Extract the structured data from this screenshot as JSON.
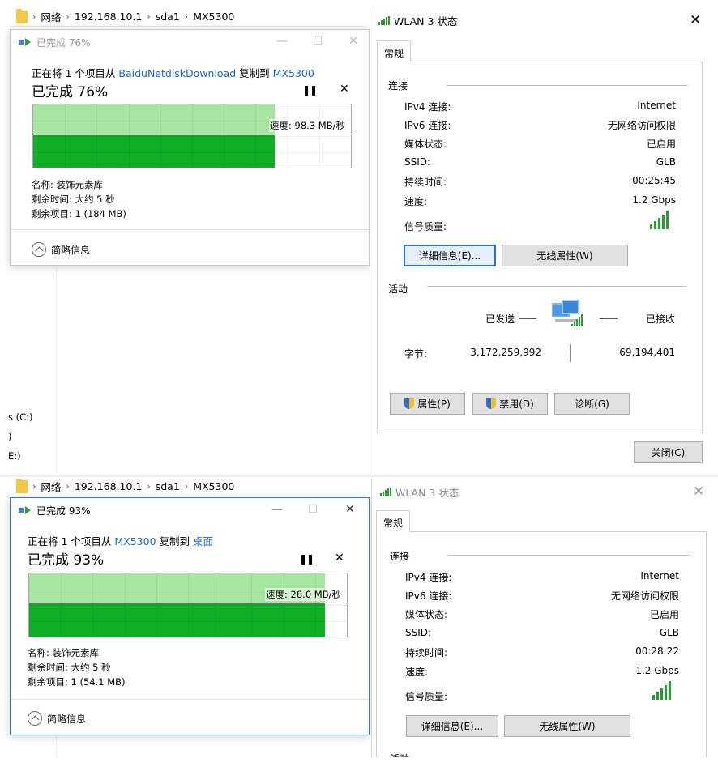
{
  "top": {
    "breadcrumb": [
      "网络",
      "192.168.10.1",
      "sda1",
      "MX5300"
    ],
    "drives": [
      "s (C:)",
      ")",
      "E:)"
    ],
    "copy": {
      "title": "已完成 76%",
      "line_prefix": "正在将 1 个项目从 ",
      "source": "BaiduNetdiskDownload",
      "line_mid": " 复制到 ",
      "dest": "MX5300",
      "percent_text": "已完成 76%",
      "progress": 0.76,
      "speed": "速度: 98.3 MB/秒",
      "name": "名称: 装饰元素库",
      "time_left": "剩余时间: 大约 5 秒",
      "items_left": "剩余项目: 1 (184 MB)",
      "less_info": "简略信息",
      "pause_icon": "pause-icon",
      "close_icon": "close-icon"
    },
    "wlan": {
      "title": "WLAN 3 状态",
      "tab": "常规",
      "connection_group": "连接",
      "rows": [
        {
          "label": "IPv4 连接:",
          "value": "Internet"
        },
        {
          "label": "IPv6 连接:",
          "value": "无网络访问权限"
        },
        {
          "label": "媒体状态:",
          "value": "已启用"
        },
        {
          "label": "SSID:",
          "value": "GLB"
        },
        {
          "label": "持续时间:",
          "value": "00:25:45"
        },
        {
          "label": "速度:",
          "value": "1.2 Gbps"
        }
      ],
      "signal_label": "信号质量:",
      "details_btn": "详细信息(E)...",
      "wireless_btn": "无线属性(W)",
      "activity_group": "活动",
      "sent_label": "已发送",
      "recv_label": "已接收",
      "bytes_label": "字节:",
      "bytes_sent": "3,172,259,992",
      "bytes_recv": "69,194,401",
      "props_btn": "属性(P)",
      "disable_btn": "禁用(D)",
      "diagnose_btn": "诊断(G)",
      "close_btn": "关闭(C)"
    }
  },
  "bottom": {
    "breadcrumb": [
      "网络",
      "192.168.10.1",
      "sda1",
      "MX5300"
    ],
    "copy": {
      "title": "已完成 93%",
      "line_prefix": "正在将 1 个项目从 ",
      "source": "MX5300",
      "line_mid": " 复制到 ",
      "dest": "桌面",
      "percent_text": "已完成 93%",
      "progress": 0.93,
      "speed": "速度: 28.0 MB/秒",
      "name": "名称: 装饰元素库",
      "time_left": "剩余时间: 大约 5 秒",
      "items_left": "剩余项目: 1 (54.1 MB)",
      "less_info": "简略信息"
    },
    "wlan": {
      "title": "WLAN 3 状态",
      "tab": "常规",
      "connection_group": "连接",
      "rows": [
        {
          "label": "IPv4 连接:",
          "value": "Internet"
        },
        {
          "label": "IPv6 连接:",
          "value": "无网络访问权限"
        },
        {
          "label": "媒体状态:",
          "value": "已启用"
        },
        {
          "label": "SSID:",
          "value": "GLB"
        },
        {
          "label": "持续时间:",
          "value": "00:28:22"
        },
        {
          "label": "速度:",
          "value": "1.2 Gbps"
        }
      ],
      "signal_label": "信号质量:",
      "details_btn": "详细信息(E)...",
      "wireless_btn": "无线属性(W)",
      "activity_group": "活动"
    }
  },
  "colors": {
    "progress_light": "#a6e6a0",
    "progress_dark": "#0eae25",
    "link": "#1e64c8",
    "signal": "#2a9a35"
  }
}
